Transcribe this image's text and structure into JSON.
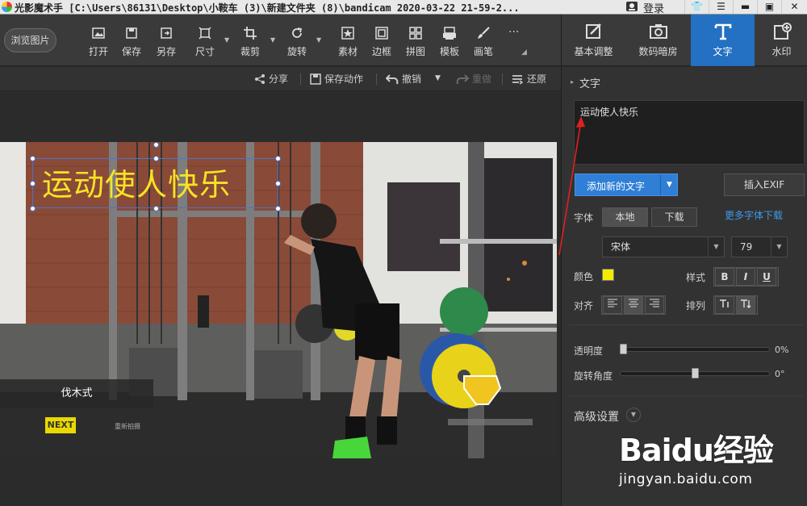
{
  "window": {
    "title": "光影魔术手  [C:\\Users\\86131\\Desktop\\小鞍车 (3)\\新建文件夹 (8)\\bandicam 2020-03-22 21-59-2...",
    "login_label": "登录"
  },
  "toolbar": {
    "browse_label": "浏览图片",
    "tools": [
      {
        "label": "打开",
        "icon": "open-image-icon"
      },
      {
        "label": "保存",
        "icon": "save-icon"
      },
      {
        "label": "另存",
        "icon": "save-as-icon"
      },
      {
        "label": "尺寸",
        "icon": "resize-icon"
      },
      {
        "label": "裁剪",
        "icon": "crop-icon"
      },
      {
        "label": "旋转",
        "icon": "rotate-icon"
      },
      {
        "label": "素材",
        "icon": "material-icon"
      },
      {
        "label": "边框",
        "icon": "border-icon"
      },
      {
        "label": "拼图",
        "icon": "collage-icon"
      },
      {
        "label": "模板",
        "icon": "template-icon"
      },
      {
        "label": "画笔",
        "icon": "brush-icon"
      }
    ],
    "more_label": "···"
  },
  "right_tabs": [
    {
      "label": "基本调整",
      "icon": "basic-adjust-icon",
      "active": false
    },
    {
      "label": "数码暗房",
      "icon": "darkroom-icon",
      "active": false
    },
    {
      "label": "文字",
      "icon": "text-icon",
      "active": true
    },
    {
      "label": "水印",
      "icon": "watermark-icon",
      "active": false
    }
  ],
  "actions": {
    "share": "分享",
    "save_action": "保存动作",
    "undo": "撤销",
    "redo": "重做",
    "restore": "还原"
  },
  "canvas": {
    "overlay_text": "运动使人快乐",
    "exercise_label": "伐木式",
    "next_badge": "NEXT",
    "next_sub": "重新拍摄"
  },
  "text_panel": {
    "section_title": "文字",
    "text_value": "运动使人快乐",
    "add_text_label": "添加新的文字",
    "insert_exif_label": "插入EXIF",
    "font_label": "字体",
    "font_source_local": "本地",
    "font_source_download": "下载",
    "more_fonts_link": "更多字体下载",
    "font_name": "宋体",
    "font_size": "79",
    "color_label": "颜色",
    "color_value": "#f4ea00",
    "style_label": "样式",
    "bold": "B",
    "italic": "I",
    "underline": "U",
    "align_label": "对齐",
    "arrange_label": "排列",
    "opacity_label": "透明度",
    "opacity_value": "0%",
    "opacity_fraction": 0.0,
    "rotation_label": "旋转角度",
    "rotation_value": "0°",
    "rotation_fraction": 0.5,
    "advanced_label": "高级设置"
  },
  "watermark": {
    "brand": "Baidu经验",
    "site": "jingyan.baidu.com"
  },
  "colors": {
    "accent": "#2470c2",
    "link": "#3d9be9",
    "text_yellow": "#f6e324"
  }
}
